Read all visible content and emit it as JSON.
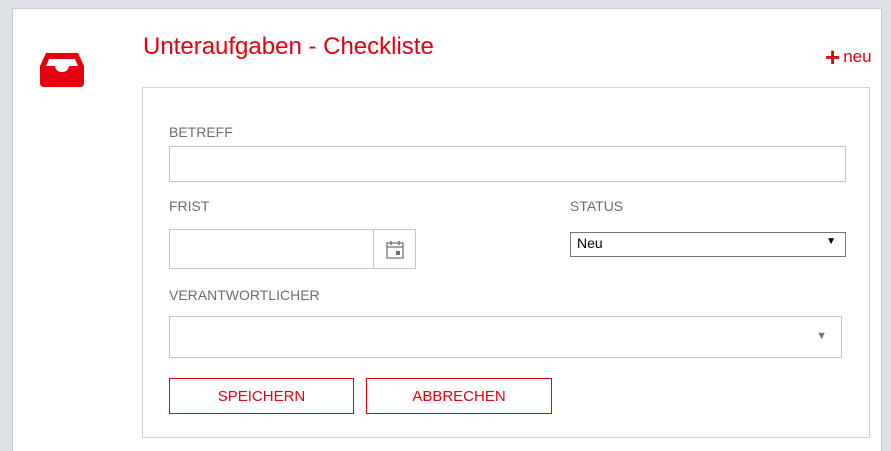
{
  "header": {
    "title": "Unteraufgaben - Checkliste",
    "new_plus": "+",
    "new_label": "neu",
    "icon": "inbox-tray-icon",
    "accent_color": "#e3000f"
  },
  "form": {
    "subject": {
      "label": "BETREFF",
      "value": ""
    },
    "deadline": {
      "label": "FRIST",
      "value": "",
      "calendar_icon": "calendar-icon"
    },
    "status": {
      "label": "STATUS",
      "selected": "Neu",
      "arrow": "▼"
    },
    "responsible": {
      "label": "VERANTWORTLICHER",
      "value": "",
      "arrow": "▼"
    },
    "save_label": "SPEICHERN",
    "cancel_label": "ABBRECHEN"
  }
}
